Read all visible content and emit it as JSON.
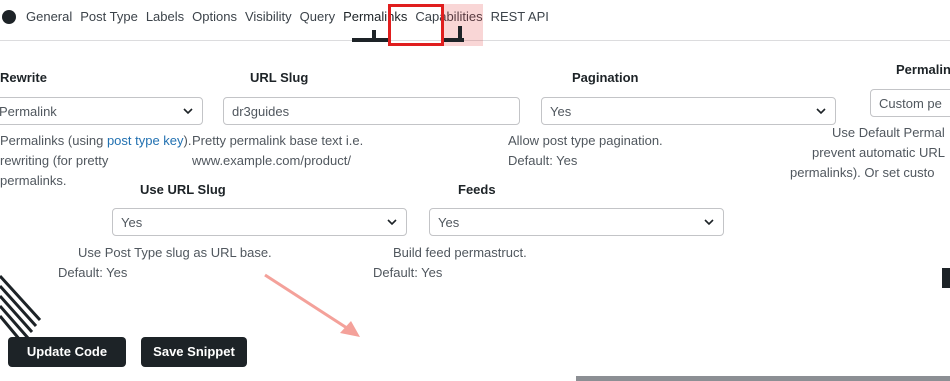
{
  "tabs": [
    "General",
    "Post Type",
    "Labels",
    "Options",
    "Visibility",
    "Query",
    "Permalinks",
    "Capabilities",
    "REST API"
  ],
  "active_tab": "Permalinks",
  "fields": {
    "rewrite": {
      "label": "Rewrite",
      "value": "Permalink",
      "desc1": "Permalinks (using ",
      "desc_link": "post type key",
      "desc1_end": ").",
      "desc2": "rewriting (for pretty",
      "desc3": "permalinks."
    },
    "url_slug": {
      "label": "URL Slug",
      "placeholder": "dr3guides",
      "desc1": "Pretty permalink base text i.e.",
      "desc2": "www.example.com/product/"
    },
    "pagination": {
      "label": "Pagination",
      "value": "Yes",
      "desc1": "Allow post type pagination.",
      "desc2": "Default: Yes"
    },
    "permalink_epmask": {
      "label": "Permalin",
      "value": "Custom pe",
      "desc1": "Use Default Permal",
      "desc2": "prevent automatic URL",
      "desc3": "permalinks). Or set custo"
    },
    "use_url_slug": {
      "label": "Use URL Slug",
      "value": "Yes",
      "desc1": "Use Post Type slug as URL base.",
      "desc2": "Default: Yes"
    },
    "feeds": {
      "label": "Feeds",
      "value": "Yes",
      "desc1": "Build feed permastruct.",
      "desc2": "Default: Yes"
    }
  },
  "buttons": {
    "update_code": "Update Code",
    "save_snippet": "Save Snippet"
  },
  "colors": {
    "highlight": "#e01e1e",
    "link": "#2271b1",
    "button_bg": "#1d2327",
    "arrow": "#f4a19a"
  }
}
